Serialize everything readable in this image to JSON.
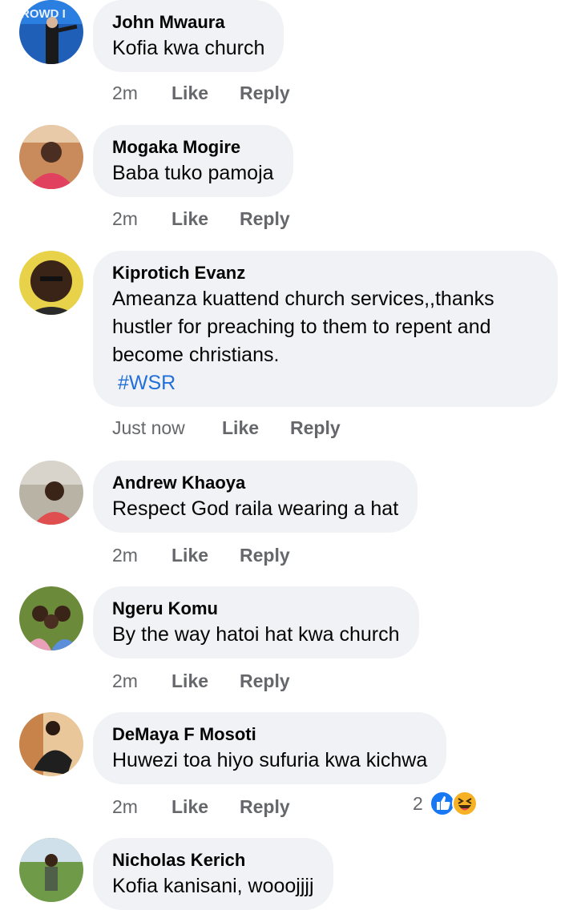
{
  "comments": [
    {
      "author": "John Mwaura",
      "text": "Kofia kwa church",
      "time": "2m",
      "like": "Like",
      "reply": "Reply"
    },
    {
      "author": "Mogaka Mogire",
      "text": "Baba tuko pamoja",
      "time": "2m",
      "like": "Like",
      "reply": "Reply"
    },
    {
      "author": "Kiprotich Evanz",
      "text_lines": [
        "Ameanza kuattend church services,,thanks",
        "hustler for preaching to them to repent and",
        "become christians."
      ],
      "hashtag": "#WSR",
      "time": "Just now",
      "like": "Like",
      "reply": "Reply"
    },
    {
      "author": "Andrew Khaoya",
      "text": "Respect God raila wearing  a hat",
      "time": "2m",
      "like": "Like",
      "reply": "Reply"
    },
    {
      "author": "Ngeru Komu",
      "text": "By the way hatoi hat kwa church",
      "time": "2m",
      "like": "Like",
      "reply": "Reply"
    },
    {
      "author": "DeMaya F Mosoti",
      "text": "Huwezi toa hiyo sufuria kwa kichwa",
      "time": "2m",
      "like": "Like",
      "reply": "Reply",
      "reactions": {
        "count": "2",
        "types": [
          "like-icon",
          "haha-icon"
        ]
      }
    },
    {
      "author": "Nicholas Kerich",
      "text": "Kofia kanisani, wooojjjj"
    }
  ],
  "avatar_text": "ROWD I",
  "colors": {
    "bubble": "#f0f2f5",
    "meta": "#65676b",
    "link": "#216fdb",
    "like_blue": "#1877f2",
    "haha_yellow": "#f7b125"
  }
}
